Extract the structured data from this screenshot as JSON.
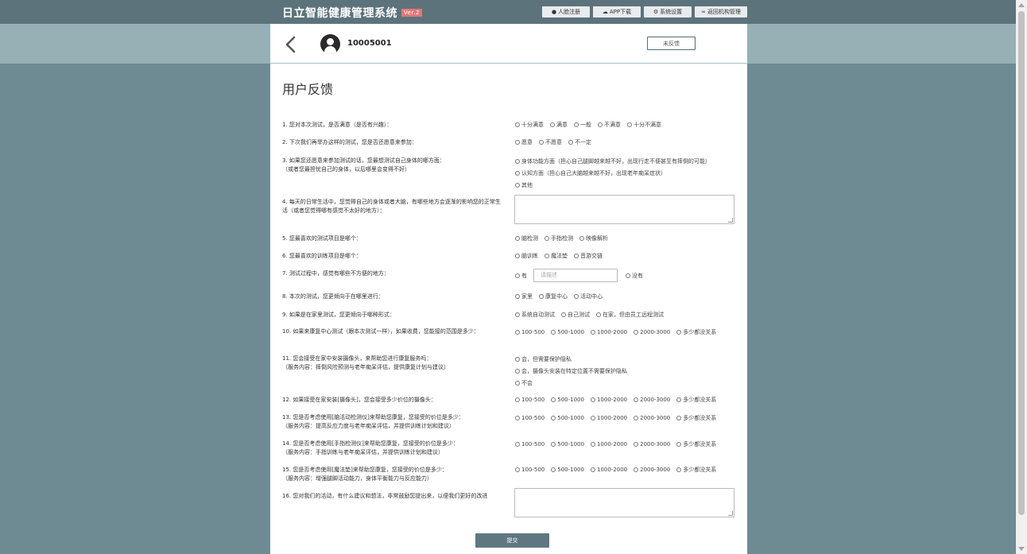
{
  "app": {
    "title": "日立智能健康管理系统",
    "version_badge": "Ver.2"
  },
  "top_nav": [
    {
      "label": "人脸注册",
      "icon": "user-icon"
    },
    {
      "label": "APP下载",
      "icon": "cloud-download-icon"
    },
    {
      "label": "系统设置",
      "icon": "gear-icon"
    },
    {
      "label": "返回机构管理",
      "icon": "link-icon"
    }
  ],
  "header": {
    "user_id": "10005001",
    "status_button": "未反馈"
  },
  "page_title": "用户反馈",
  "questions": [
    {
      "text": "1. 您对本次测试，是否满意（是否有兴趣）：",
      "options": [
        "十分满意",
        "满意",
        "一般",
        "不满意",
        "十分不满意"
      ]
    },
    {
      "text": "2. 下次我们再举办这样的测试，您是否还愿意来参加：",
      "options": [
        "愿意",
        "不愿意",
        "不一定"
      ]
    },
    {
      "text": "3. 如果您还愿意来参加测试的话，您最想测试自己身体的哪方面：\n（或者您最担忧自己的身体，以后哪里会变得不好）",
      "options": [
        "身体功能方面（担心自己腿脚越来越不好，出现行走不便甚至有摔倒的可能）",
        "认知方面（担心自己大脑越来越不好，出现老年痴呆症状）",
        "其他"
      ]
    },
    {
      "text": "4. 每天的日常生活中，您觉得自己的身体或者大脑，有哪些地方会逐渐的影响您的正常生活（或者您觉得哪有感觉不太好的地方）："
    },
    {
      "text": "5. 您最喜欢的测试项目是哪个：",
      "options": [
        "脑检测",
        "手指检测",
        "映像解析"
      ]
    },
    {
      "text": "6. 您最喜欢的训练项目是哪个：",
      "options": [
        "脑训练",
        "魔法垫",
        "音游交链"
      ]
    },
    {
      "text": "7. 测试过程中，感觉有哪些不方便的地方：",
      "options": [
        "有",
        "没有"
      ],
      "placeholder": "请描述"
    },
    {
      "text": "8. 本次的测试，您更倾向于在哪里进行：",
      "options": [
        "家里",
        "康复中心",
        "活动中心"
      ]
    },
    {
      "text": "9. 如果是在家里测试，您更倾向于哪种形式：",
      "options": [
        "系统自动测试",
        "自己测试",
        "在家，但由员工远程测试"
      ]
    },
    {
      "text": "10. 如果来康复中心测试（跟本次测试一样），如果收费，您能接的范围是多少：",
      "options": [
        "100-500",
        "500-1000",
        "1000-2000",
        "2000-3000",
        "多少都没关系"
      ]
    },
    {
      "text": "11. 您会接受在家中安装摄像头，来帮助您进行康复服务吗：\n（服务内容：摔倒风险预测与老年痴呆评估，提供康复计划与建议）",
      "options": [
        "会，但需要保护隐私",
        "会，摄像头安装在特定位置不需要保护隐私",
        "不会"
      ]
    },
    {
      "text": "12. 如果接受在家安装[摄像头]，您会接受多少价位的摄像头：",
      "options": [
        "100-500",
        "500-1000",
        "1000-2000",
        "2000-3000",
        "多少都没关系"
      ]
    },
    {
      "text": "13. 您是否考虑使用[脑活动检测仪]来帮助您康复，您接受的价位是多少：\n（服务内容：提高反应力度与老年痴呆评估，并提供训练计划和建议）",
      "options": [
        "100-500",
        "500-1000",
        "1000-2000",
        "2000-3000",
        "多少都没关系"
      ]
    },
    {
      "text": "14. 您是否考虑使用[手指检测仪]来帮助您康复，您接受的价位是多少：\n（服务内容：手指训练与老年痴呆评估，并提供训练计划和建议）",
      "options": [
        "100-500",
        "500-1000",
        "1000-2000",
        "2000-3000",
        "多少都没关系"
      ]
    },
    {
      "text": "15. 您是否考虑使用[魔法垫]来帮助您康复，您接受的价位是多少：\n（服务内容：增强腿脚活动能力，身体平衡能力与反应能力）",
      "options": [
        "100-500",
        "500-1000",
        "1000-2000",
        "2000-3000",
        "多少都没关系"
      ]
    },
    {
      "text": "16. 您对我们的活动，有什么建议和想法，非常鼓励您提出来，以便我们更好的改进"
    }
  ],
  "submit_label": "提交"
}
